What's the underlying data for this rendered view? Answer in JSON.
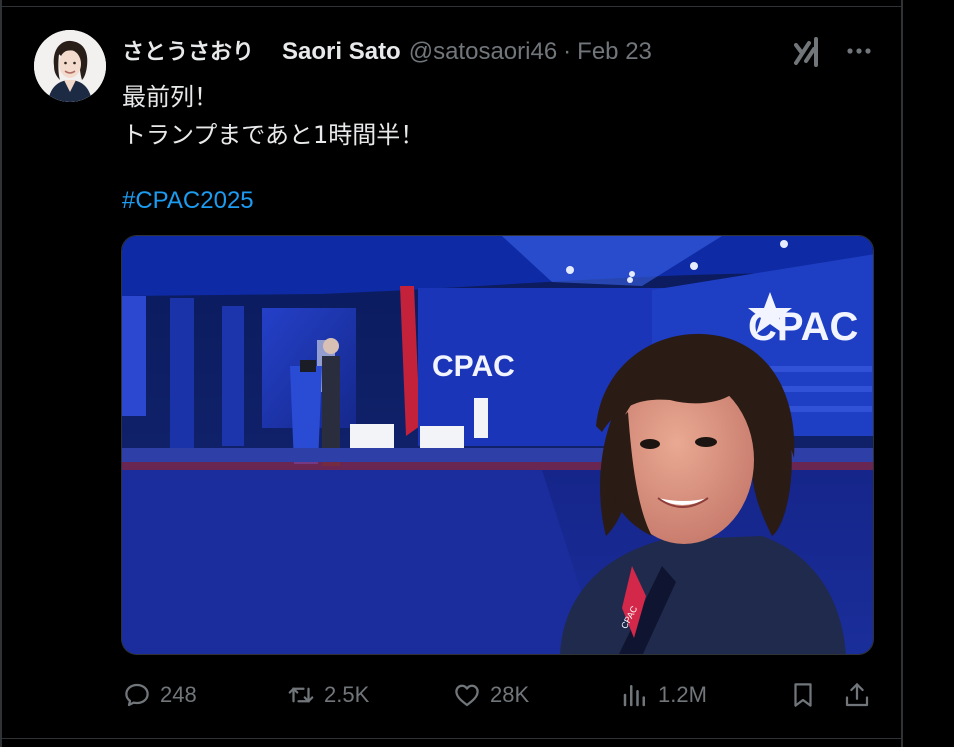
{
  "tweet": {
    "display_name": "さとうさおり",
    "alt_name": "Saori Sato",
    "handle": "@satosaori46",
    "separator": "·",
    "date": "Feb 23",
    "text_line1": "最前列！",
    "text_line2": "トランプまであと1時間半！",
    "hashtag": "#CPAC2025"
  },
  "media": {
    "stage_logo_left": "CPAC",
    "stage_logo_right": "CPAC",
    "lanyard_text": "CPAC"
  },
  "actions": {
    "reply_count": "248",
    "retweet_count": "2.5K",
    "like_count": "28K",
    "view_count": "1.2M"
  },
  "icons": {
    "grok": "grok-icon",
    "more": "more-icon",
    "reply": "reply-icon",
    "retweet": "retweet-icon",
    "like": "heart-icon",
    "views": "views-icon",
    "bookmark": "bookmark-icon",
    "share": "share-icon"
  },
  "colors": {
    "background": "#000000",
    "text": "#e7e9ea",
    "muted": "#71767b",
    "hashtag": "#1d9bf0",
    "border": "#2f3336"
  }
}
